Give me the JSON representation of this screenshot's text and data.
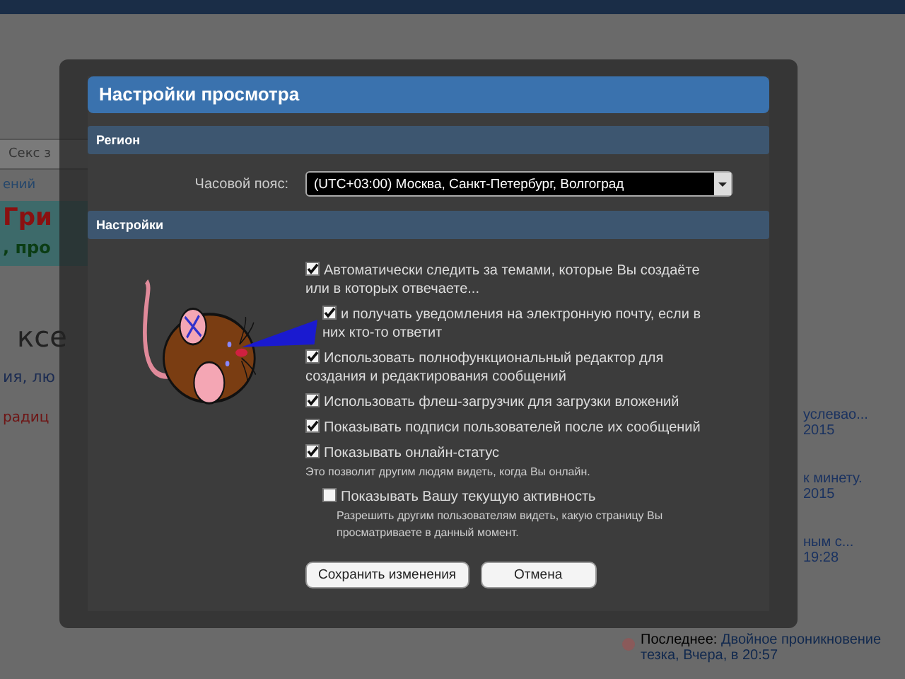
{
  "background_page": {
    "left_fragments": [
      {
        "kind": "tab",
        "text": "Секс з"
      },
      {
        "kind": "nav",
        "text": "ений"
      },
      {
        "kind": "banner_title",
        "text": "Гри"
      },
      {
        "kind": "banner_subtitle",
        "text": ", про"
      },
      {
        "kind": "heading",
        "text": "ксе"
      },
      {
        "kind": "tagline",
        "text": "ия, лю"
      },
      {
        "kind": "red_text",
        "text": "радиц"
      }
    ],
    "right_items": [
      {
        "kind": "partial",
        "lines": [
          "услевао...",
          "2015"
        ]
      },
      {
        "kind": "partial",
        "lines": [
          "к минету.",
          "2015"
        ]
      },
      {
        "kind": "partial",
        "lines": [
          "ным с...",
          "19:28"
        ]
      },
      {
        "kind": "full",
        "prefix": "Последнее:",
        "link": "Двойное проникновение",
        "lines": [
          "тезка, Вчера, в 20:57"
        ]
      }
    ]
  },
  "dialog": {
    "title": "Настройки просмотра",
    "region": {
      "heading": "Регион",
      "timezone": {
        "label": "Часовой пояс:",
        "value": "(UTC+03:00) Москва, Санкт-Петербург, Волгоград"
      }
    },
    "settings": {
      "heading": "Настройки",
      "options": [
        {
          "label": "Автоматически следить за темами, которые Вы создаёте или в которых отвечаете...",
          "checked": true,
          "children": [
            {
              "label": "и получать уведомления на электронную почту, если в них кто-то ответит",
              "checked": true
            }
          ]
        },
        {
          "label": "Использовать полнофункциональный редактор для создания и редактирования сообщений",
          "checked": true
        },
        {
          "label": "Использовать флеш-загрузчик для загрузки вложений",
          "checked": true
        },
        {
          "label": "Показывать подписи пользователей после их сообщений",
          "checked": true
        },
        {
          "label": "Показывать онлайн-статус",
          "checked": true,
          "description": "Это позволит другим людям видеть, когда Вы онлайн.",
          "children": [
            {
              "label": "Показывать Вашу текущую активность",
              "checked": false,
              "description": "Разрешить другим пользователям видеть, какую страницу Вы просматриваете в данный момент."
            }
          ]
        }
      ]
    },
    "buttons": [
      {
        "label": "Сохранить изменения"
      },
      {
        "label": "Отмена"
      }
    ]
  }
}
